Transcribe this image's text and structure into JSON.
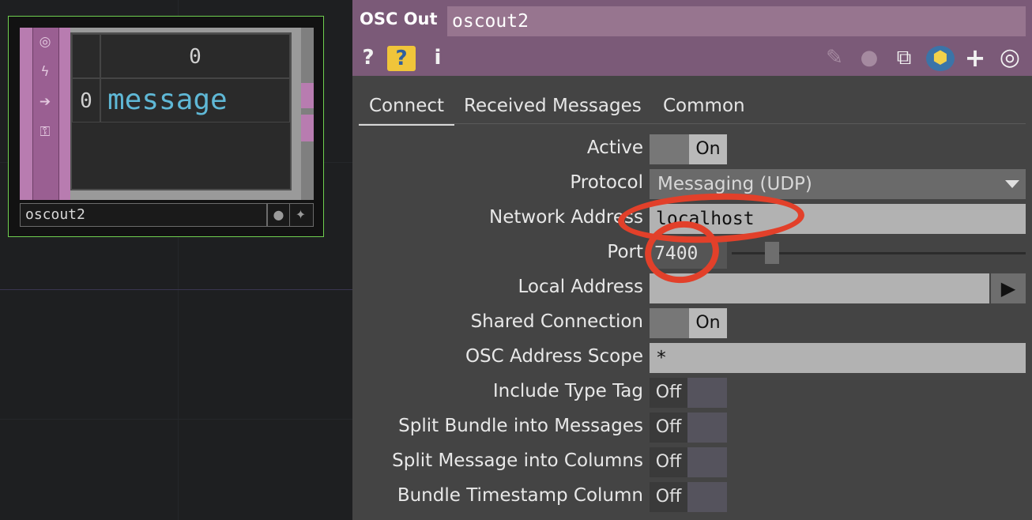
{
  "node": {
    "table_header_value": "0",
    "row_index": "0",
    "row_message": "message",
    "name": "oscout2",
    "strip_icons": [
      "target-icon",
      "bolt-icon",
      "arrow-right-icon",
      "lock-icon"
    ]
  },
  "panel": {
    "op_type": "OSC Out",
    "op_name": "oscout2",
    "header_icons": {
      "help": "?",
      "python_help": "?",
      "info": "i",
      "edit": "✎",
      "comment": "💬",
      "clone": "⧉",
      "python": "⬢",
      "add": "+",
      "viewer": "◎"
    },
    "tabs": [
      "Connect",
      "Received Messages",
      "Common"
    ],
    "active_tab": "Connect",
    "params": {
      "active": {
        "label": "Active",
        "value": "On"
      },
      "protocol": {
        "label": "Protocol",
        "value": "Messaging (UDP)"
      },
      "network_address": {
        "label": "Network Address",
        "value": "localhost"
      },
      "port": {
        "label": "Port",
        "value": "7400"
      },
      "local_address": {
        "label": "Local Address",
        "value": "",
        "play": "▶"
      },
      "shared_connection": {
        "label": "Shared Connection",
        "value": "On"
      },
      "osc_address_scope": {
        "label": "OSC Address Scope",
        "value": "*"
      },
      "include_type_tag": {
        "label": "Include Type Tag",
        "value": "Off"
      },
      "split_bundle": {
        "label": "Split Bundle into Messages",
        "value": "Off"
      },
      "split_message": {
        "label": "Split Message into Columns",
        "value": "Off"
      },
      "bundle_timestamp": {
        "label": "Bundle Timestamp Column",
        "value": "Off"
      }
    }
  },
  "colors": {
    "header": "#7b5a78",
    "node_border": "#6fcf4f",
    "annotation": "#e2402a",
    "message_text": "#5fb8d6"
  }
}
